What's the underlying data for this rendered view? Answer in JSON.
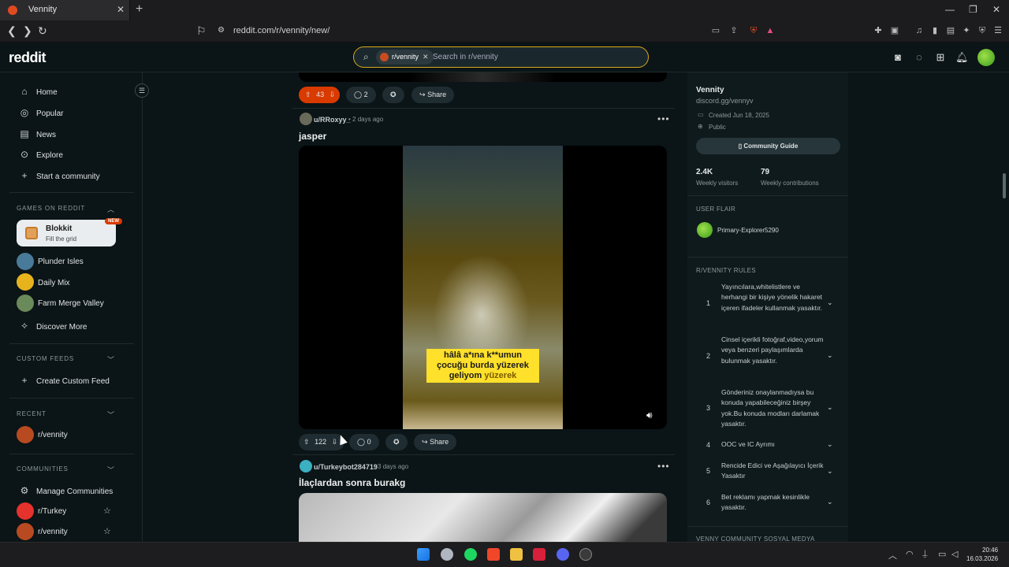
{
  "browser": {
    "tab_title": "Vennity",
    "url": "reddit.com/r/vennity/new/"
  },
  "header": {
    "logo": "reddit",
    "search_chip": "r/vennity",
    "search_placeholder": "Search in r/vennity"
  },
  "sidebar": {
    "nav": [
      "Home",
      "Popular",
      "News",
      "Explore",
      "Start a community"
    ],
    "games_title": "GAMES ON REDDIT",
    "featured_game": {
      "name": "Blokkit",
      "subtitle": "Fill the grid",
      "badge": "NEW"
    },
    "games": [
      "Plunder Isles",
      "Daily Mix",
      "Farm Merge Valley",
      "Discover More"
    ],
    "custom_feeds_title": "CUSTOM FEEDS",
    "create_custom_feed": "Create Custom Feed",
    "recent_title": "RECENT",
    "recent": [
      "r/vennity"
    ],
    "communities_title": "COMMUNITIES",
    "manage_communities": "Manage Communities",
    "communities": [
      "r/Turkey",
      "r/vennity"
    ]
  },
  "feed": {
    "prev_post": {
      "upvotes": "43",
      "comments": "2",
      "share": "Share"
    },
    "post1": {
      "author": "u/RRoxyy_",
      "time": "2 days ago",
      "title": "jasper",
      "caption_line1": "hâlâ a*ına k**umun",
      "caption_line2": "çocuğu burda yüzerek",
      "caption_line3a": "geliyom",
      "caption_line3b": "yüzerek",
      "upvotes": "122",
      "comments": "0",
      "share": "Share"
    },
    "post2": {
      "author": "u/Turkeybot284719",
      "time": "3 days ago",
      "title": "İlaçlardan sonra burakg"
    }
  },
  "right": {
    "community_name": "Vennity",
    "discord": "discord.gg/vennyv",
    "created": "Created Jun 18, 2025",
    "visibility": "Public",
    "guide_button": "Community Guide",
    "weekly_visitors_value": "2.4K",
    "weekly_visitors_label": "Weekly visitors",
    "weekly_contrib_value": "79",
    "weekly_contrib_label": "Weekly contributions",
    "user_flair_title": "USER FLAIR",
    "user_flair_name": "Primary-Explorer5290",
    "rules_title": "R/VENNITY RULES",
    "rules": [
      {
        "n": "1",
        "text": "Yayıncılara,whitelistlere ve herhangi bir kişiye yönelik hakaret içeren ifadeler kullanmak yasaktır."
      },
      {
        "n": "2",
        "text": "Cinsel içerikli fotoğraf,video,yorum veya benzeri paylaşımlarda bulunmak yasaktır."
      },
      {
        "n": "3",
        "text": "Gönderiniz onaylanmadıysa bu konuda yapabileceğiniz birşey yok.Bu konuda modları darlamak yasaktır."
      },
      {
        "n": "4",
        "text": "OOC ve IC Ayrımı"
      },
      {
        "n": "5",
        "text": "Rencide Edici ve Aşağılayıcı İçerik Yasaktır"
      },
      {
        "n": "6",
        "text": "Bet reklamı yapmak kesinlikle yasaktır."
      }
    ],
    "social_title": "VENNY COMMUNITY SOSYAL MEDYA"
  },
  "taskbar": {
    "time": "20:46",
    "date": "16.03.2026"
  },
  "colors": {
    "accent_orange": "#d93a00",
    "search_border": "#d9a81a",
    "caption_yellow": "#ffe02a"
  }
}
